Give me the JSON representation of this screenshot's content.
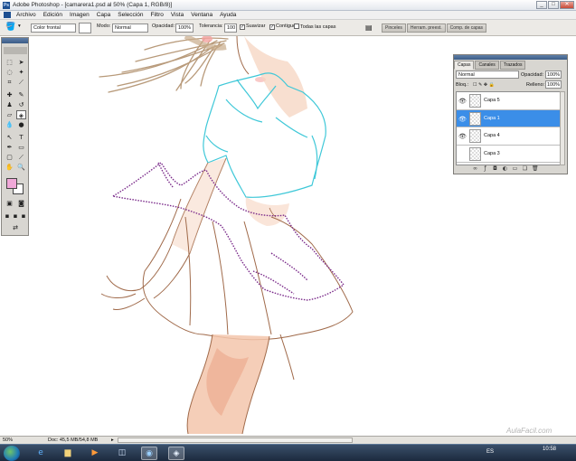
{
  "window": {
    "title": "Adobe Photoshop - [camarera1.psd al 50% (Capa 1, RGB/8)]",
    "btn_min": "_",
    "btn_max": "□",
    "btn_close": "✕"
  },
  "menu": [
    "Archivo",
    "Edición",
    "Imagen",
    "Capa",
    "Selección",
    "Filtro",
    "Vista",
    "Ventana",
    "Ayuda"
  ],
  "options": {
    "fill_source": "Color frontal",
    "mode_label": "Modo:",
    "mode_value": "Normal",
    "opacity_label": "Opacidad:",
    "opacity_value": "100%",
    "tolerance_label": "Tolerancia:",
    "tolerance_value": "100",
    "smooth_label": "Suavizar",
    "contiguous_label": "Contiguo",
    "all_layers_label": "Todas las capas"
  },
  "panel_tabs": [
    "Pinceles",
    "Herram. preest.",
    "Comp. de capas"
  ],
  "layers_panel": {
    "tabs": [
      "Capas",
      "Canales",
      "Trazados"
    ],
    "blend_mode": "Normal",
    "opacity_label": "Opacidad:",
    "opacity_value": "100%",
    "lock_label": "Bloq.:",
    "fill_label": "Relleno:",
    "fill_value": "100%",
    "layers": [
      {
        "name": "Capa 5",
        "visible": true,
        "selected": false
      },
      {
        "name": "Capa 1",
        "visible": true,
        "selected": true
      },
      {
        "name": "Capa 4",
        "visible": true,
        "selected": false
      },
      {
        "name": "Capa 3",
        "visible": false,
        "selected": false
      }
    ]
  },
  "status": {
    "zoom": "50%",
    "doc": "Doc: 45,5 MB/54,8 MB"
  },
  "taskbar": {
    "language": "ES",
    "time": "10:58"
  },
  "watermark": "AulaFacil.com",
  "colors": {
    "selection": "#3b8ee8",
    "foreground_swatch": "#f0a8d8",
    "line_cyan": "#3fc8d8",
    "line_brown": "#a06a4a"
  }
}
